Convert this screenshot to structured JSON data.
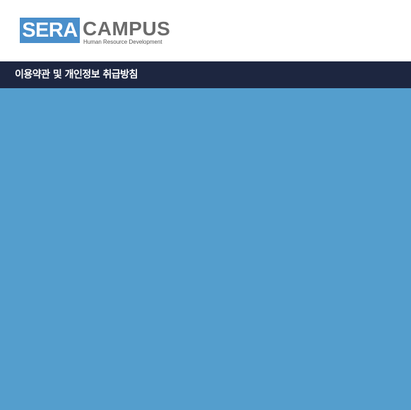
{
  "header": {
    "logo": {
      "mark": "SERA",
      "wordmark": "CAMPUS",
      "tagline": "Human Resource Development"
    }
  },
  "titlebar": {
    "title": "이용약관 및 개인정보 취급방침"
  },
  "colors": {
    "logo_blue": "#4a8fcb",
    "titlebar_bg": "#1d2640",
    "content_bg": "#549ecd"
  }
}
